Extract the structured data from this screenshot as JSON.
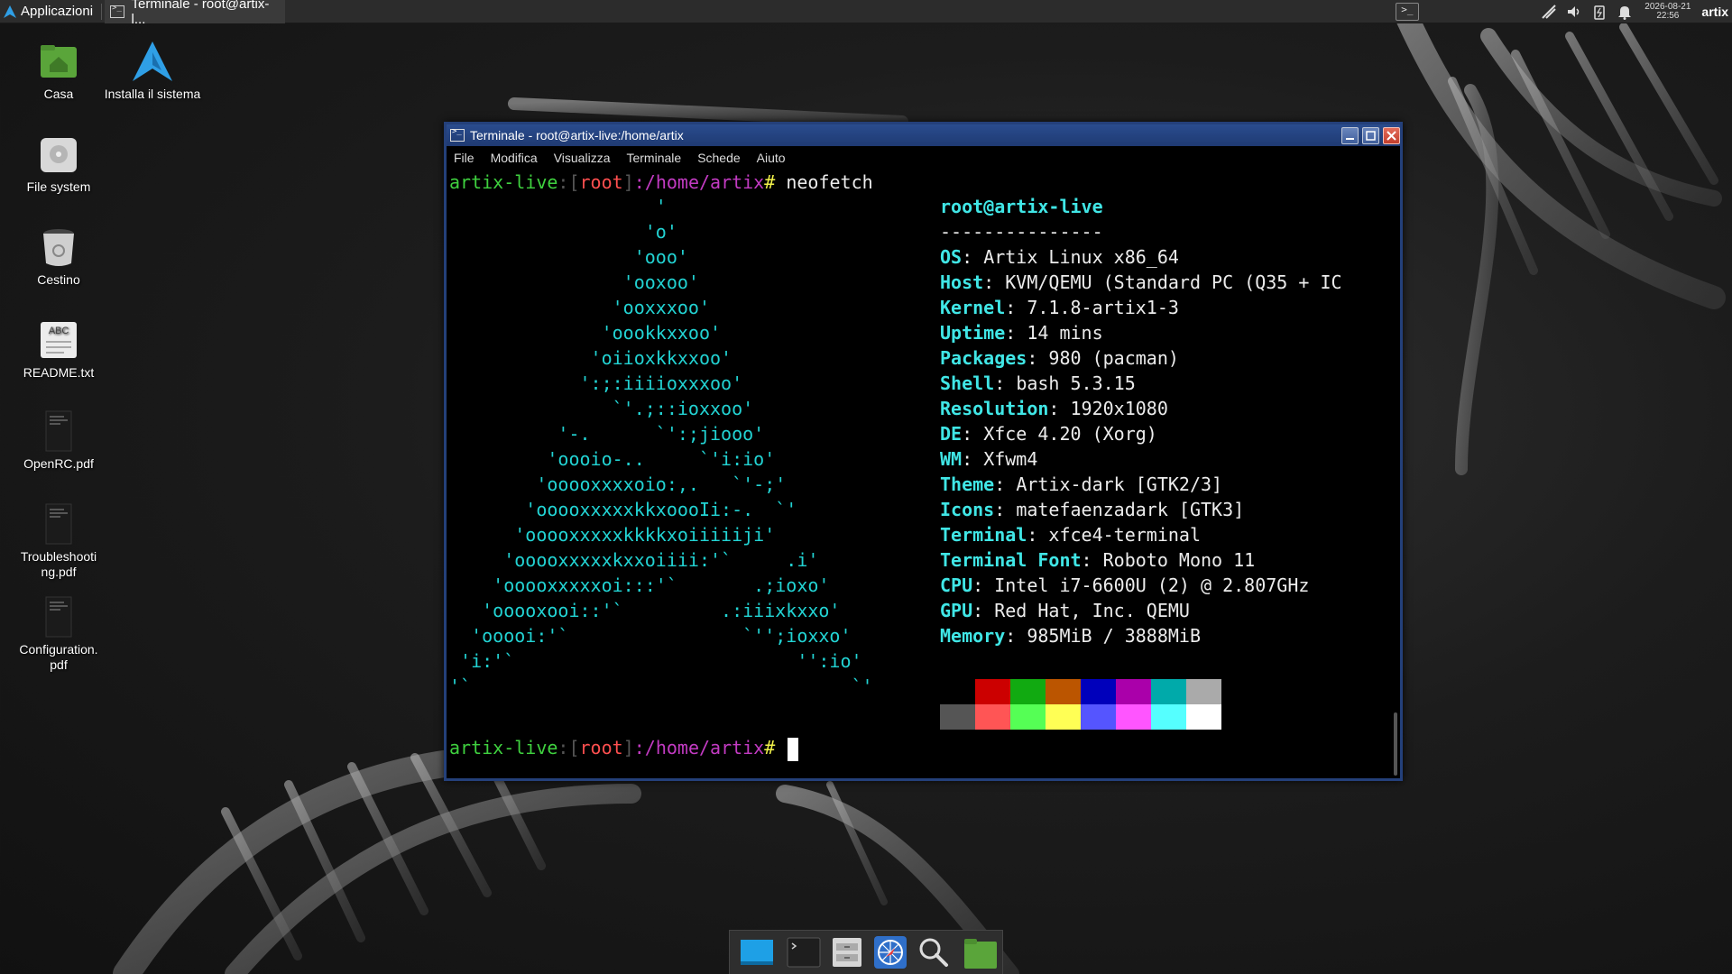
{
  "top_panel": {
    "apps_menu_label": "Applicazioni",
    "task_button_label": "Terminale - root@artix-l...",
    "clock_date": "2026-08-21",
    "clock_time": "22:56",
    "user": "artix"
  },
  "desktop_icons": [
    {
      "label": "Casa",
      "icon": "home-folder-icon"
    },
    {
      "label": "Installa il sistema",
      "icon": "artix-installer-icon"
    },
    {
      "label": "File system",
      "icon": "drive-icon"
    },
    {
      "label": "Cestino",
      "icon": "trash-icon"
    },
    {
      "label": "README.txt",
      "icon": "text-file-icon"
    },
    {
      "label": "OpenRC.pdf",
      "icon": "pdf-icon"
    },
    {
      "label": "Troubleshooting.pdf",
      "icon": "pdf-icon"
    },
    {
      "label": "Configuration.pdf",
      "icon": "pdf-icon"
    }
  ],
  "terminal": {
    "title": "Terminale - root@artix-live:/home/artix",
    "menu": [
      "File",
      "Modifica",
      "Visualizza",
      "Terminale",
      "Schede",
      "Aiuto"
    ],
    "prompt": {
      "host": "artix-live",
      "user": "root",
      "path": ":/home/artix",
      "symbol": "#"
    },
    "command": "neofetch",
    "ascii_art": [
      "                   '",
      "                  'o'",
      "                 'ooo'",
      "                'ooxoo'",
      "               'ooxxxoo'",
      "              'oookkxxoo'",
      "             'oiioxkkxxoo'",
      "            ':;:iiiioxxxoo'",
      "               `'.;::ioxxoo'",
      "          '-.      `':;jiooo'",
      "         'oooio-..     `'i:io'",
      "        'ooooxxxxoio:,.   `'-;'",
      "       'ooooxxxxxkkxoooIi:-.  `'",
      "      'ooooxxxxxkkkkxoiiiiiji'",
      "     'ooooxxxxxkxxoiiii:'`     .i'",
      "    'ooooxxxxxoi:::'`       .;ioxo'",
      "   'ooooxooi::'`         .:iiixkxxo'",
      "  'ooooi:'`                `'';ioxxo'",
      " 'i:'`                          '':io'",
      "'`                                   `'"
    ],
    "header": "root@artix-live",
    "separator": "---------------",
    "info": [
      {
        "key": "OS",
        "value": "Artix Linux x86_64"
      },
      {
        "key": "Host",
        "value": "KVM/QEMU (Standard PC (Q35 + IC"
      },
      {
        "key": "Kernel",
        "value": "7.1.8-artix1-3"
      },
      {
        "key": "Uptime",
        "value": "14 mins"
      },
      {
        "key": "Packages",
        "value": "980 (pacman)"
      },
      {
        "key": "Shell",
        "value": "bash 5.3.15"
      },
      {
        "key": "Resolution",
        "value": "1920x1080"
      },
      {
        "key": "DE",
        "value": "Xfce 4.20 (Xorg)"
      },
      {
        "key": "WM",
        "value": "Xfwm4"
      },
      {
        "key": "Theme",
        "value": "Artix-dark [GTK2/3]"
      },
      {
        "key": "Icons",
        "value": "matefaenzadark [GTK3]"
      },
      {
        "key": "Terminal",
        "value": "xfce4-terminal"
      },
      {
        "key": "Terminal Font",
        "value": "Roboto Mono 11"
      },
      {
        "key": "CPU",
        "value": "Intel i7-6600U (2) @ 2.807GHz"
      },
      {
        "key": "GPU",
        "value": "Red Hat, Inc. QEMU"
      },
      {
        "key": "Memory",
        "value": "985MiB / 3888MiB"
      }
    ],
    "palette": [
      "#000000",
      "#cc0000",
      "#11aa11",
      "#bb5500",
      "#0000bb",
      "#aa00aa",
      "#00aaaa",
      "#aaaaaa",
      "#555555",
      "#ff5555",
      "#55ff55",
      "#ffff55",
      "#5555ff",
      "#ff55ff",
      "#55ffff",
      "#ffffff"
    ]
  },
  "dock": [
    {
      "name": "show-desktop",
      "icon": "show-desktop-icon"
    },
    {
      "name": "terminal",
      "icon": "terminal-icon"
    },
    {
      "name": "file-manager",
      "icon": "file-manager-icon"
    },
    {
      "name": "web-browser",
      "icon": "browser-icon"
    },
    {
      "name": "app-finder",
      "icon": "search-icon"
    },
    {
      "name": "home-folder",
      "icon": "folder-icon"
    }
  ]
}
